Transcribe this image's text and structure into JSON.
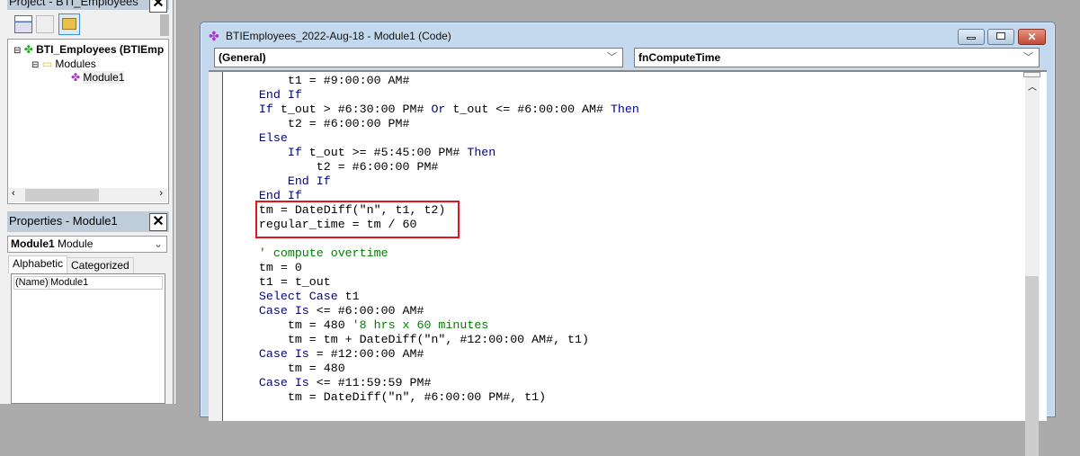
{
  "project": {
    "title": "Project - BTI_Employees",
    "tree": {
      "root": "BTI_Employees (BTIEmp",
      "folder": "Modules",
      "module": "Module1"
    }
  },
  "properties": {
    "title": "Properties - Module1",
    "object_name": "Module1",
    "object_type": "Module",
    "tabs": [
      "Alphabetic",
      "Categorized"
    ],
    "rows": [
      {
        "name": "(Name)",
        "value": "Module1"
      }
    ]
  },
  "code_window": {
    "title": "BTIEmployees_2022-Aug-18 - Module1 (Code)",
    "object_dropdown": "(General)",
    "procedure_dropdown": "fnComputeTime"
  },
  "code_lines": [
    [
      [
        1,
        ""
      ],
      [
        "p",
        "t1 = #9:00:00 AM#"
      ]
    ],
    [
      [
        0,
        ""
      ],
      [
        "k",
        "End If"
      ]
    ],
    [
      [
        0,
        ""
      ],
      [
        "k",
        "If"
      ],
      [
        "p",
        " t_out > #6:30:00 PM# "
      ],
      [
        "k",
        "Or"
      ],
      [
        "p",
        " t_out <= #6:00:00 AM# "
      ],
      [
        "k",
        "Then"
      ]
    ],
    [
      [
        1,
        ""
      ],
      [
        "p",
        "t2 = #6:00:00 PM#"
      ]
    ],
    [
      [
        0,
        ""
      ],
      [
        "k",
        "Else"
      ]
    ],
    [
      [
        1,
        ""
      ],
      [
        "k",
        "If"
      ],
      [
        "p",
        " t_out >= #5:45:00 PM# "
      ],
      [
        "k",
        "Then"
      ]
    ],
    [
      [
        2,
        ""
      ],
      [
        "p",
        "t2 = #6:00:00 PM#"
      ]
    ],
    [
      [
        1,
        ""
      ],
      [
        "k",
        "End If"
      ]
    ],
    [
      [
        0,
        ""
      ],
      [
        "k",
        "End If"
      ]
    ],
    [
      [
        0,
        ""
      ],
      [
        "p",
        "tm = DateDiff(\"n\", t1, t2)"
      ]
    ],
    [
      [
        0,
        ""
      ],
      [
        "p",
        "regular_time = tm / 60"
      ]
    ],
    [
      [
        0,
        ""
      ]
    ],
    [
      [
        0,
        ""
      ],
      [
        "c",
        "' compute overtime"
      ]
    ],
    [
      [
        0,
        ""
      ],
      [
        "p",
        "tm = 0"
      ]
    ],
    [
      [
        0,
        ""
      ],
      [
        "p",
        "t1 = t_out"
      ]
    ],
    [
      [
        0,
        ""
      ],
      [
        "k",
        "Select Case"
      ],
      [
        "p",
        " t1"
      ]
    ],
    [
      [
        0,
        ""
      ],
      [
        "k",
        "Case Is"
      ],
      [
        "p",
        " <= #6:00:00 AM#"
      ]
    ],
    [
      [
        1,
        ""
      ],
      [
        "p",
        "tm = 480 "
      ],
      [
        "c",
        "'8 hrs x 60 minutes"
      ]
    ],
    [
      [
        1,
        ""
      ],
      [
        "p",
        "tm = tm + DateDiff(\"n\", #12:00:00 AM#, t1)"
      ]
    ],
    [
      [
        0,
        ""
      ],
      [
        "k",
        "Case Is"
      ],
      [
        "p",
        " = #12:00:00 AM#"
      ]
    ],
    [
      [
        1,
        ""
      ],
      [
        "p",
        "tm = 480"
      ]
    ],
    [
      [
        0,
        ""
      ],
      [
        "k",
        "Case Is"
      ],
      [
        "p",
        " <= #11:59:59 PM#"
      ]
    ],
    [
      [
        1,
        ""
      ],
      [
        "p",
        "tm = DateDiff(\"n\", #6:00:00 PM#, t1)"
      ]
    ]
  ],
  "colors": {
    "keyword": "#00008b",
    "comment": "#008000",
    "highlight": "#e3141b"
  }
}
